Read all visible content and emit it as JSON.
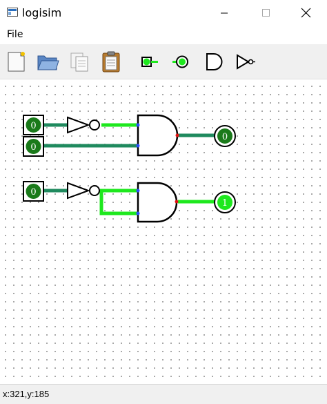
{
  "window": {
    "title": "logisim"
  },
  "menu": {
    "items": [
      {
        "label": "File"
      }
    ]
  },
  "toolbar": {
    "buttons": [
      {
        "name": "new-icon"
      },
      {
        "name": "open-folder-icon"
      },
      {
        "name": "copy-icon"
      },
      {
        "name": "paste-clipboard-icon"
      },
      {
        "name": "input-pin-tool-icon"
      },
      {
        "name": "output-pin-tool-icon"
      },
      {
        "name": "and-gate-tool-icon"
      },
      {
        "name": "not-gate-tool-icon"
      }
    ]
  },
  "circuit": {
    "inputs": [
      {
        "value": "0"
      },
      {
        "value": "0"
      },
      {
        "value": "0"
      }
    ],
    "outputs": [
      {
        "value": "0"
      },
      {
        "value": "1"
      }
    ]
  },
  "colors": {
    "wire_low": "#1f8a5e",
    "wire_high": "#1ee81e",
    "pin_fill": "#1a7a1a",
    "port_input": "#2a4cff",
    "port_output": "#e01010"
  },
  "status": {
    "coords": "x:321,y:185"
  }
}
